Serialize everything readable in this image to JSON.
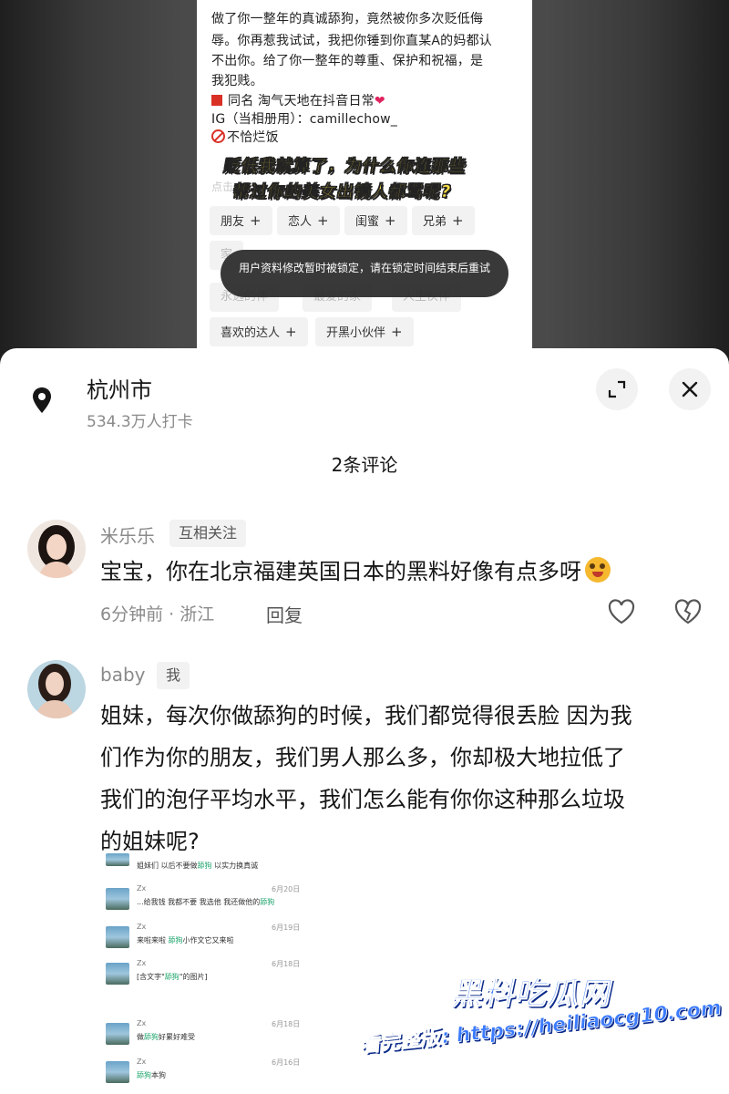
{
  "background_profile": {
    "bio_lines": [
      "做了你一整年的真诚舔狗，竟然被你多次贬低侮",
      "辱。你再惹我试试，我把你锤到你直某A的妈都认",
      "不出你。给了你一整年的尊重、保护和祝福，是",
      "我犯贱。"
    ],
    "same_name": "同名   淘气天地在抖音日常",
    "ig": "IG（当相册用）：camillechow_",
    "no_rice": "不恰烂饭",
    "faded_hint": "点击",
    "caption_line1": "贬低我就算了，为什么你连那些",
    "caption_line2": "帮过你的美女出镜人都骂呢?",
    "tags_row1": [
      "朋友",
      "恋人",
      "闺蜜",
      "兄弟"
    ],
    "tags_row2_faded": [
      "家",
      "永远的伴",
      "最爱的家",
      "人生伙伴"
    ],
    "tags_row3": [
      "喜欢的达人",
      "开黑小伙伴"
    ],
    "toast": "用户资料修改暂时被锁定，请在锁定时间结束后重试"
  },
  "sheet": {
    "location_title": "杭州市",
    "location_sub": "534.3万人打卡",
    "comment_count": "2条评论",
    "icons": {
      "location": "location-pin-icon",
      "expand": "expand-icon",
      "close": "close-icon"
    }
  },
  "comments": [
    {
      "username": "米乐乐",
      "badge": "互相关注",
      "text": "宝宝，你在北京福建英国日本的黑料好像有点多呀",
      "meta": "6分钟前 · 浙江",
      "reply": "回复"
    },
    {
      "username": "baby",
      "badge": "我",
      "text_lines": [
        "姐妹，每次你做舔狗的时候，我们都觉得很丢脸   因为我",
        "们作为你的朋友，我们男人那么多，你却极大地拉低了",
        "我们的泡仔平均水平，我们怎么能有你你这种那么垃圾",
        "的姐妹呢?"
      ]
    }
  ],
  "chat_screenshot": {
    "header": "姐妹们  以后不要做舔狗  以实力换真诚",
    "rows": [
      {
        "name": "Zx",
        "msg": "...给我钱  我都不要  我选他  我还做他的舔狗",
        "date": "6月20日"
      },
      {
        "name": "Zx",
        "msg": "来啦来啦  舔狗小作文它又来啦",
        "date": "6月19日"
      },
      {
        "name": "Zx",
        "msg": "[含文字\"舔狗\"的图片]",
        "date": "6月18日"
      },
      {
        "name": "Zx",
        "msg": "做舔狗好累好难受",
        "date": "6月18日"
      },
      {
        "name": "Zx",
        "msg": "舔狗本狗",
        "date": "6月16日"
      }
    ]
  },
  "watermark": {
    "logo": "黑料吃瓜网",
    "url": "看完整版: https://heiliaocg10.com"
  }
}
